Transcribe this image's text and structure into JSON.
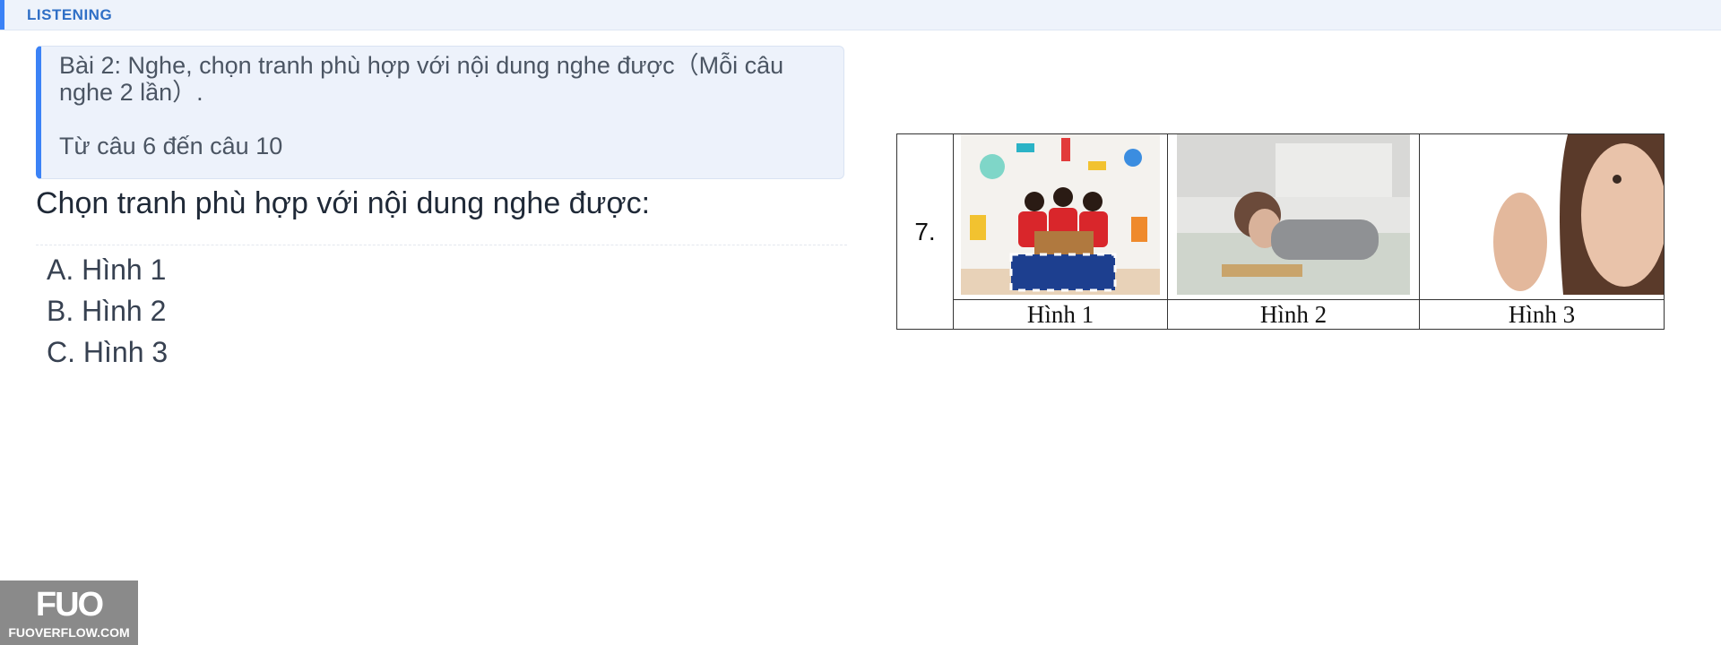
{
  "header": {
    "section_label": "LISTENING"
  },
  "instructions": {
    "line1": "Bài 2: Nghe, chọn tranh phù hợp với nội dung nghe được（Mỗi câu",
    "line2": "nghe 2 lần）.",
    "range": "Từ câu 6 đến câu 10"
  },
  "question": {
    "prompt": "Chọn tranh phù hợp với nội dung nghe được:",
    "options": [
      "A. Hình 1",
      "B. Hình 2",
      "C. Hình 3"
    ]
  },
  "figure": {
    "number": "7.",
    "captions": [
      "Hình 1",
      "Hình 2",
      "Hình 3"
    ]
  },
  "watermark": {
    "logo": "FUO",
    "url": "FUOVERFLOW.COM"
  }
}
